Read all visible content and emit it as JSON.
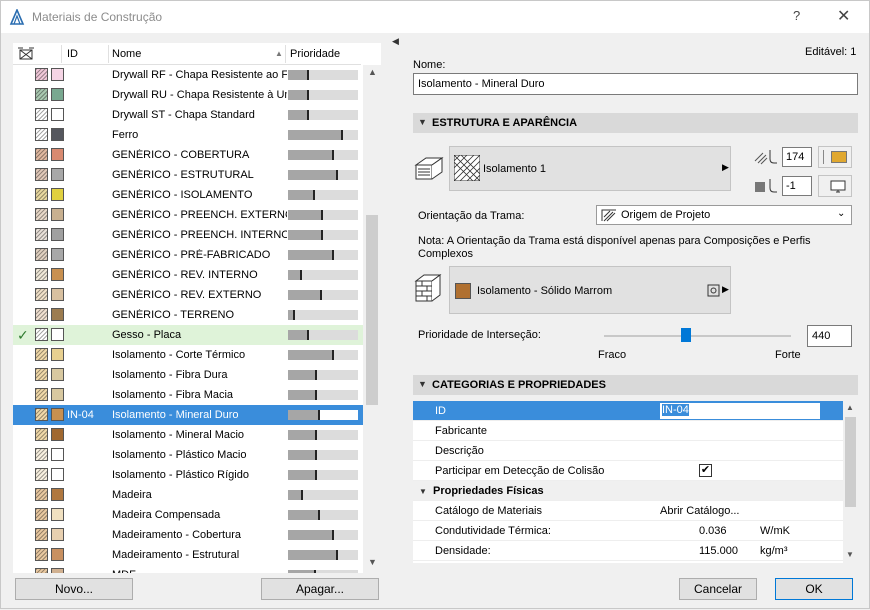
{
  "window": {
    "title": "Materiais de Construção",
    "help": "?",
    "close": "✕"
  },
  "list": {
    "headers": {
      "id": "ID",
      "name": "Nome",
      "priority": "Prioridade"
    },
    "rows": [
      {
        "id": "",
        "name": "Drywall RF - Chapa Resistente ao Fogo",
        "priority": 0.3,
        "c1": "#f0c8d8",
        "c2": "#f5d5e5"
      },
      {
        "id": "",
        "name": "Drywall RU - Chapa Resistente à Umidade",
        "priority": 0.3,
        "c1": "#a9c8b0",
        "c2": "#79a890"
      },
      {
        "id": "",
        "name": "Drywall ST - Chapa Standard",
        "priority": 0.3,
        "c1": "#ffffff",
        "c2": "#ffffff"
      },
      {
        "id": "",
        "name": "Ferro",
        "priority": 0.78,
        "c1": "#ffffff",
        "c2": "#55575e"
      },
      {
        "id": "",
        "name": "GENÉRICO - COBERTURA",
        "priority": 0.65,
        "c1": "#e0b8a0",
        "c2": "#d88a70"
      },
      {
        "id": "",
        "name": "GENÉRICO - ESTRUTURAL",
        "priority": 0.72,
        "c1": "#e0c8b8",
        "c2": "#a8a8a8"
      },
      {
        "id": "",
        "name": "GENÉRICO - ISOLAMENTO",
        "priority": 0.38,
        "c1": "#e8d8a0",
        "c2": "#e0d040"
      },
      {
        "id": "",
        "name": "GENÉRICO - PREENCH. EXTERNO",
        "priority": 0.5,
        "c1": "#e8d8c8",
        "c2": "#c8b090"
      },
      {
        "id": "",
        "name": "GENÉRICO - PREENCH. INTERNO",
        "priority": 0.5,
        "c1": "#e8e0d8",
        "c2": "#a0a0a0"
      },
      {
        "id": "",
        "name": "GENÉRICO - PRÉ-FABRICADO",
        "priority": 0.65,
        "c1": "#e0d0c0",
        "c2": "#a8a8a8"
      },
      {
        "id": "",
        "name": "GENÉRICO - REV.  INTERNO",
        "priority": 0.2,
        "c1": "#f0e8d8",
        "c2": "#c89050"
      },
      {
        "id": "",
        "name": "GENÉRICO - REV. EXTERNO",
        "priority": 0.48,
        "c1": "#f0e0c8",
        "c2": "#d8c0a0"
      },
      {
        "id": "",
        "name": "GENÉRICO - TERRENO",
        "priority": 0.1,
        "c1": "#f0e0d0",
        "c2": "#9c7c50"
      },
      {
        "id": "",
        "name": "Gesso - Placa",
        "priority": 0.3,
        "c1": "#ffffff",
        "c2": "#ffffff"
      },
      {
        "id": "",
        "name": "Isolamento - Corte Térmico",
        "priority": 0.65,
        "c1": "#f0d8a8",
        "c2": "#e8d090"
      },
      {
        "id": "",
        "name": "Isolamento - Fibra Dura",
        "priority": 0.42,
        "c1": "#f0d8a8",
        "c2": "#d8c8a0"
      },
      {
        "id": "",
        "name": "Isolamento - Fibra Macia",
        "priority": 0.42,
        "c1": "#f0d8a8",
        "c2": "#d8c8a0"
      },
      {
        "id": "IN-04",
        "name": "Isolamento - Mineral Duro",
        "priority": 0.45,
        "c1": "#f0d8a8",
        "c2": "#c89050"
      },
      {
        "id": "",
        "name": "Isolamento - Mineral Macio",
        "priority": 0.42,
        "c1": "#f0d8a8",
        "c2": "#a06830"
      },
      {
        "id": "",
        "name": "Isolamento - Plástico Macio",
        "priority": 0.42,
        "c1": "#f8f0e0",
        "c2": "#ffffff"
      },
      {
        "id": "",
        "name": "Isolamento - Plástico Rígido",
        "priority": 0.42,
        "c1": "#f8f0e0",
        "c2": "#ffffff"
      },
      {
        "id": "",
        "name": "Madeira",
        "priority": 0.22,
        "c1": "#e8c8a0",
        "c2": "#b07840"
      },
      {
        "id": "",
        "name": "Madeira Compensada",
        "priority": 0.45,
        "c1": "#e8c8a0",
        "c2": "#f0e0c0"
      },
      {
        "id": "",
        "name": "Madeiramento - Cobertura",
        "priority": 0.65,
        "c1": "#e8c8a0",
        "c2": "#e8d0b0"
      },
      {
        "id": "",
        "name": "Madeiramento - Estrutural",
        "priority": 0.72,
        "c1": "#e8c8a0",
        "c2": "#c89060"
      },
      {
        "id": "",
        "name": "MDF",
        "priority": 0.4,
        "c1": "#e8c8a0",
        "c2": "#d0b090"
      }
    ],
    "selected_index": 17,
    "green_index": 13,
    "new_button": "Novo...",
    "delete_button": "Apagar..."
  },
  "details": {
    "editable": "Editável: 1",
    "name_label": "Nome:",
    "name_value": "Isolamento - Mineral Duro",
    "structure": {
      "title": "ESTRUTURA E APARÊNCIA",
      "fill_name": "Isolamento 1",
      "pen_value": "174",
      "pen_color": "#e0a830",
      "bg_value": "-1",
      "orientation_label": "Orientação da Trama:",
      "orientation_value": "Origem de Projeto",
      "note": "Nota: A Orientação da Trama está disponível apenas para Composições e Perfis Complexos",
      "surface_name": "Isolamento - Sólido Marrom",
      "surface_color": "#b07030",
      "priority_label": "Prioridade de Interseção:",
      "priority_value": "440",
      "priority_fraction": 0.44,
      "weak_label": "Fraco",
      "strong_label": "Forte"
    },
    "categories": {
      "title": "CATEGORIAS E PROPRIEDADES",
      "rows": [
        {
          "key": "ID",
          "value": "IN-04",
          "unit": "",
          "type": "hl"
        },
        {
          "key": "Fabricante",
          "value": "",
          "unit": ""
        },
        {
          "key": "Descrição",
          "value": "",
          "unit": ""
        },
        {
          "key": "Participar em Detecção de Colisão",
          "value": "✔",
          "unit": "",
          "type": "check"
        },
        {
          "key": "Propriedades Físicas",
          "value": "",
          "unit": "",
          "type": "group"
        },
        {
          "key": "Catálogo de Materiais",
          "value": "Abrir Catálogo...",
          "unit": ""
        },
        {
          "key": "Condutividade Térmica:",
          "value": "0.036",
          "unit": "W/mK"
        },
        {
          "key": "Densidade:",
          "value": "115.000",
          "unit": "kg/m³"
        }
      ]
    },
    "cancel_button": "Cancelar",
    "ok_button": "OK"
  }
}
